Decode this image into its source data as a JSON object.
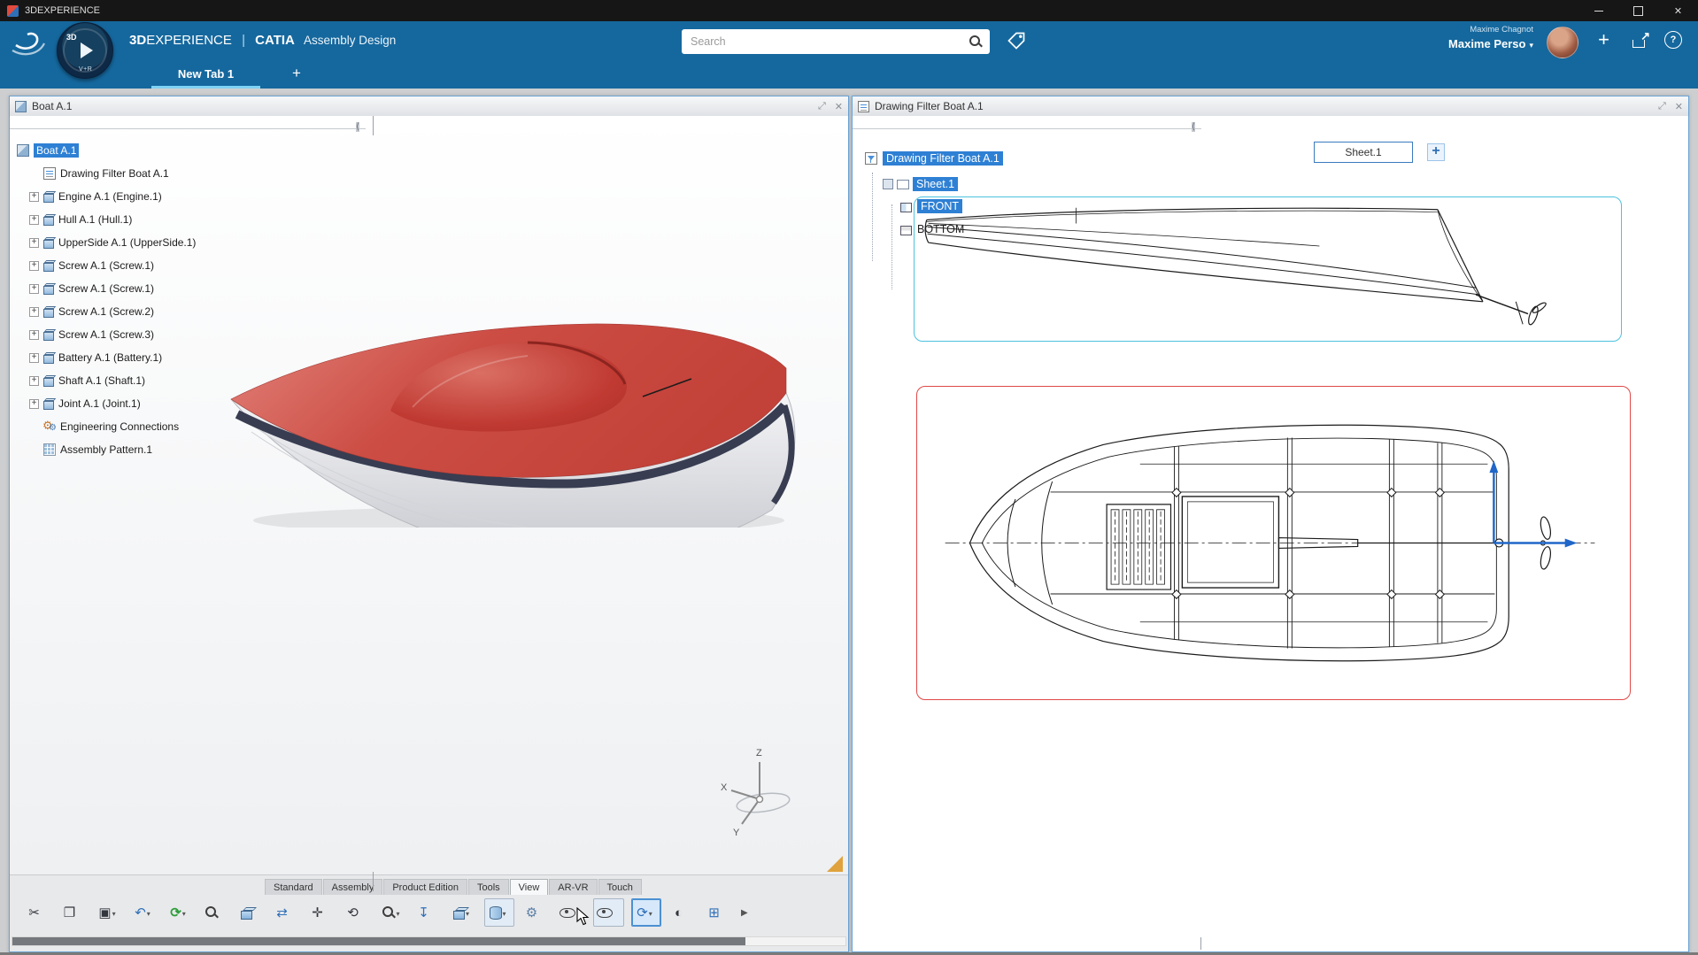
{
  "window": {
    "title": "3DEXPERIENCE"
  },
  "header": {
    "brand_bold": "3D",
    "brand_rest": "EXPERIENCE",
    "separator": "|",
    "app_name": "CATIA",
    "app_workbench": "Assembly Design",
    "search_placeholder": "Search",
    "user_account": "Maxime Chagnot",
    "user_profile": "Maxime Perso",
    "compass_top": "3D",
    "compass_bottom": "V+R"
  },
  "tabs": {
    "items": [
      {
        "label": "New Tab 1"
      }
    ],
    "add_label": "+"
  },
  "left_window": {
    "title": "Boat A.1",
    "tree": [
      {
        "label": "Boat A.1",
        "cls": "root sel",
        "icon": "ic-product",
        "icon_name": "product-icon"
      },
      {
        "label": "Drawing Filter Boat A.1",
        "cls": "",
        "icon": "ic-drawing",
        "icon_name": "drawing-icon"
      },
      {
        "label": "Engine A.1 (Engine.1)",
        "cls": "has-exp",
        "icon": "ic-part",
        "icon_name": "part-icon"
      },
      {
        "label": "Hull A.1 (Hull.1)",
        "cls": "has-exp",
        "icon": "ic-part",
        "icon_name": "part-icon"
      },
      {
        "label": "UpperSide A.1 (UpperSide.1)",
        "cls": "has-exp",
        "icon": "ic-part",
        "icon_name": "part-icon"
      },
      {
        "label": "Screw A.1 (Screw.1)",
        "cls": "has-exp",
        "icon": "ic-part",
        "icon_name": "part-icon"
      },
      {
        "label": "Screw A.1 (Screw.1)",
        "cls": "has-exp",
        "icon": "ic-part",
        "icon_name": "part-icon"
      },
      {
        "label": "Screw A.1 (Screw.2)",
        "cls": "has-exp",
        "icon": "ic-part",
        "icon_name": "part-icon"
      },
      {
        "label": "Screw A.1 (Screw.3)",
        "cls": "has-exp",
        "icon": "ic-part",
        "icon_name": "part-icon"
      },
      {
        "label": "Battery A.1 (Battery.1)",
        "cls": "has-exp",
        "icon": "ic-part",
        "icon_name": "part-icon"
      },
      {
        "label": "Shaft A.1 (Shaft.1)",
        "cls": "has-exp",
        "icon": "ic-part",
        "icon_name": "part-icon"
      },
      {
        "label": "Joint A.1 (Joint.1)",
        "cls": "has-exp",
        "icon": "ic-part",
        "icon_name": "part-icon"
      },
      {
        "label": "Engineering Connections",
        "cls": "",
        "icon": "ic-conn",
        "icon_name": "connections-icon"
      },
      {
        "label": "Assembly Pattern.1",
        "cls": "",
        "icon": "ic-pattern",
        "icon_name": "pattern-icon"
      }
    ],
    "toolbar_tabs": [
      {
        "label": "Standard",
        "cls": ""
      },
      {
        "label": "Assembly",
        "cls": ""
      },
      {
        "label": "Product Edition",
        "cls": ""
      },
      {
        "label": "Tools",
        "cls": ""
      },
      {
        "label": "View",
        "cls": "active"
      },
      {
        "label": "AR-VR",
        "cls": ""
      },
      {
        "label": "Touch",
        "cls": ""
      }
    ],
    "toolbar_icons": [
      {
        "name": "cut-icon",
        "glyph": "✂",
        "cls": "c-dark",
        "box": "",
        "ddc": ""
      },
      {
        "name": "copy-icon",
        "glyph": "❐",
        "cls": "c-dark",
        "box": "",
        "ddc": ""
      },
      {
        "name": "paste-icon",
        "glyph": "▣",
        "cls": "c-dark",
        "box": "",
        "ddc": "on"
      },
      {
        "name": "undo-icon",
        "glyph": "↶",
        "cls": "c-blue",
        "box": "",
        "ddc": "on"
      },
      {
        "name": "update-icon",
        "glyph": "⟳",
        "cls": "c-green",
        "box": "",
        "ddc": "on"
      },
      {
        "name": "fit-all-icon",
        "glyph": "",
        "cls": "i-mag",
        "box": "",
        "ddc": ""
      },
      {
        "name": "iso-view-icon",
        "glyph": "",
        "cls": "i-cube",
        "box": "",
        "ddc": ""
      },
      {
        "name": "center-view-icon",
        "glyph": "⇄",
        "cls": "c-blue",
        "box": "",
        "ddc": ""
      },
      {
        "name": "pan-icon",
        "glyph": "✛",
        "cls": "c-dark",
        "box": "",
        "ddc": ""
      },
      {
        "name": "orbit-icon",
        "glyph": "⟲",
        "cls": "c-dark",
        "box": "",
        "ddc": ""
      },
      {
        "name": "zoom-icon",
        "glyph": "",
        "cls": "i-mag",
        "box": "",
        "ddc": "on"
      },
      {
        "name": "normal-view-icon",
        "glyph": "↧",
        "cls": "c-blue",
        "box": "",
        "ddc": ""
      },
      {
        "name": "view-cube-icon",
        "glyph": "",
        "cls": "i-cube",
        "box": "",
        "ddc": "on"
      },
      {
        "name": "section-icon",
        "glyph": "",
        "cls": "i-cyl",
        "box": "boxed",
        "ddc": "on"
      },
      {
        "name": "mechanism-icon",
        "glyph": "⚙",
        "cls": "c-steel",
        "box": "",
        "ddc": ""
      },
      {
        "name": "hide-show-icon",
        "glyph": "",
        "cls": "i-eye",
        "box": "",
        "ddc": ""
      },
      {
        "name": "visibility-icon",
        "glyph": "",
        "cls": "i-eye",
        "box": "boxed",
        "ddc": ""
      },
      {
        "name": "turntable-icon",
        "glyph": "⟳",
        "cls": "c-blue",
        "box": "boxed active",
        "ddc": "on"
      },
      {
        "name": "render-style-icon",
        "glyph": "◐",
        "cls": "c-dark",
        "box": "",
        "ddc": ""
      },
      {
        "name": "split-view-icon",
        "glyph": "⊞",
        "cls": "c-blue",
        "box": "",
        "ddc": ""
      }
    ],
    "axis": {
      "z": "Z",
      "x": "X",
      "y": "Y"
    }
  },
  "right_window": {
    "title": "Drawing Filter Boat A.1",
    "tree_root": "Drawing Filter Boat A.1",
    "sheet_label": "Sheet.1",
    "views": [
      {
        "label": "FRONT",
        "cls": "hl",
        "icon": "ic-view",
        "icon_name": "front-view-icon"
      },
      {
        "label": "BOTTOM",
        "cls": "",
        "icon": "ic-view v2",
        "icon_name": "bottom-view-icon"
      }
    ],
    "sheet_tab": "Sheet.1",
    "add_sheet_label": "+"
  },
  "icons": {
    "close": "✕",
    "window_expand": "⤢",
    "window_close": "✕",
    "collapse_panel": "⟨",
    "caret_down": "▾",
    "add": "+",
    "share": "↗",
    "help": "?",
    "overflow_arrow": "▶",
    "search": "css-magnifier",
    "tag": "svg-tag-shape",
    "play": "css-triangle",
    "minimize": "css-bar",
    "maximize": "css-square"
  },
  "colors": {
    "header_blue": "#15689e",
    "selection_blue": "#2e80d4",
    "front_frame_cyan": "#4cc2e0",
    "bottom_frame_red": "#e04848",
    "deck_red": "#c8423a",
    "accent_blue": "#2f6fb8"
  }
}
